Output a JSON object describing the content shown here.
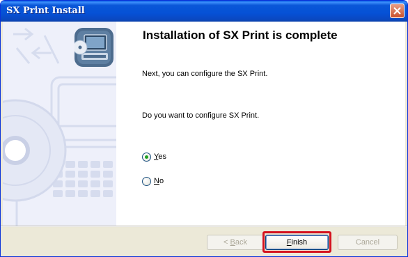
{
  "window": {
    "title": "SX Print Install",
    "close_icon": "close-icon"
  },
  "main": {
    "heading": "Installation of SX Print is complete",
    "line1": "Next, you can configure the SX Print.",
    "line2": "Do you want to configure SX Print.",
    "options": [
      {
        "mnemonic": "Y",
        "rest": "es",
        "selected": true
      },
      {
        "mnemonic": "N",
        "rest": "o",
        "selected": false
      }
    ]
  },
  "buttons": {
    "back": {
      "prefix": "< ",
      "mnemonic": "B",
      "rest": "ack",
      "enabled": false
    },
    "finish": {
      "mnemonic": "F",
      "rest": "inish",
      "enabled": true
    },
    "cancel": {
      "label": "Cancel",
      "enabled": false
    }
  },
  "colors": {
    "titlebar": "#0a57d8",
    "highlight": "#d4121e"
  }
}
